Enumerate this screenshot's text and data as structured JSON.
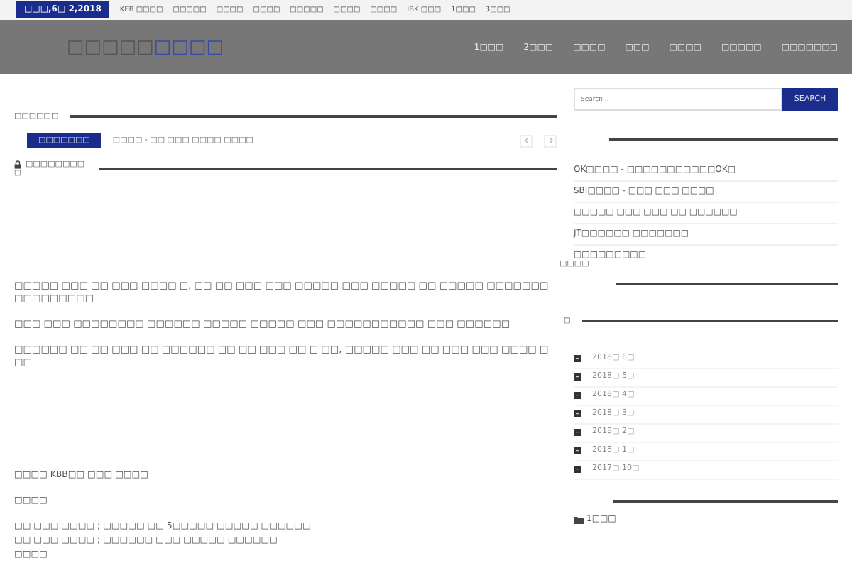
{
  "top_bar": {
    "date": "□□□,6□ 2,2018",
    "links": [
      "KEB □□□□",
      "□□□□□",
      "□□□□",
      "□□□□",
      "□□□□□",
      "□□□□",
      "□□□□",
      "IBK □□□",
      "1□□□",
      "3□□□"
    ]
  },
  "header": {
    "logo": [
      {
        "text": "□□□□□",
        "accent": false
      },
      {
        "text": "□□□□",
        "accent": true
      }
    ],
    "nav": [
      "1□□□",
      "2□□□",
      "□□□□",
      "□□□",
      "□□□□",
      "□□□□□",
      "□□□□□□□"
    ]
  },
  "main": {
    "section_title": "□□□□□□",
    "ticker": {
      "badge": "□□□□□□□",
      "headline": "□□□□ - □□ □□□ □□□□ □□□□"
    },
    "post_title": "□□□□□□□□",
    "post_sub": "□",
    "paragraphs": [
      "□□□□□ □□□ □□ □□□ □□□□ □, □□ □□ □□□ □□□ □□□□□ □□□ □□□□□ □□ □□□□□ □□□□□□□□□□□□□□□□",
      "□□□ □□□ □□□□□□□□ □□□□□□ □□□□□ □□□□□ □□□ □□□□□□□□□□□ □□□ □□□□□□",
      "□□□□□□ □□ □□ □□□ □□ □□□□□□ □□ □□ □□□ □□ □ □□, □□□□□ □□□ □□ □□□ □□□ □□□□ □□□"
    ],
    "lines": [
      "□□□□ KBB□□ □□□ □□□□",
      "□□□□",
      "□□ □□□.□□□□ ; □□□□□ □□ 5□□□□□ □□□□□ □□□□□□\n□□ □□□.□□□□ ; □□□□□□ □□□ □□□□□ □□□□□□\n□□□□"
    ]
  },
  "sidebar": {
    "search": {
      "placeholder": "Search...",
      "button": "SEARCH"
    },
    "recent": [
      "OK□□□□ - □□□□□□□□□□□OK□",
      "SBI□□□□ - □□□ □□□ □□□□",
      "□□□□□ □□□ □□□ □□ □□□□□□",
      "JT□□□□□□ □□□□□□□",
      "□□□□□□□□□"
    ],
    "widget_title": "□□□□",
    "archive_title": "□",
    "archives": [
      "2018□ 6□",
      "2018□ 5□",
      "2018□ 4□",
      "2018□ 3□",
      "2018□ 2□",
      "2018□ 1□",
      "2017□ 10□"
    ],
    "category": "1□□□"
  }
}
